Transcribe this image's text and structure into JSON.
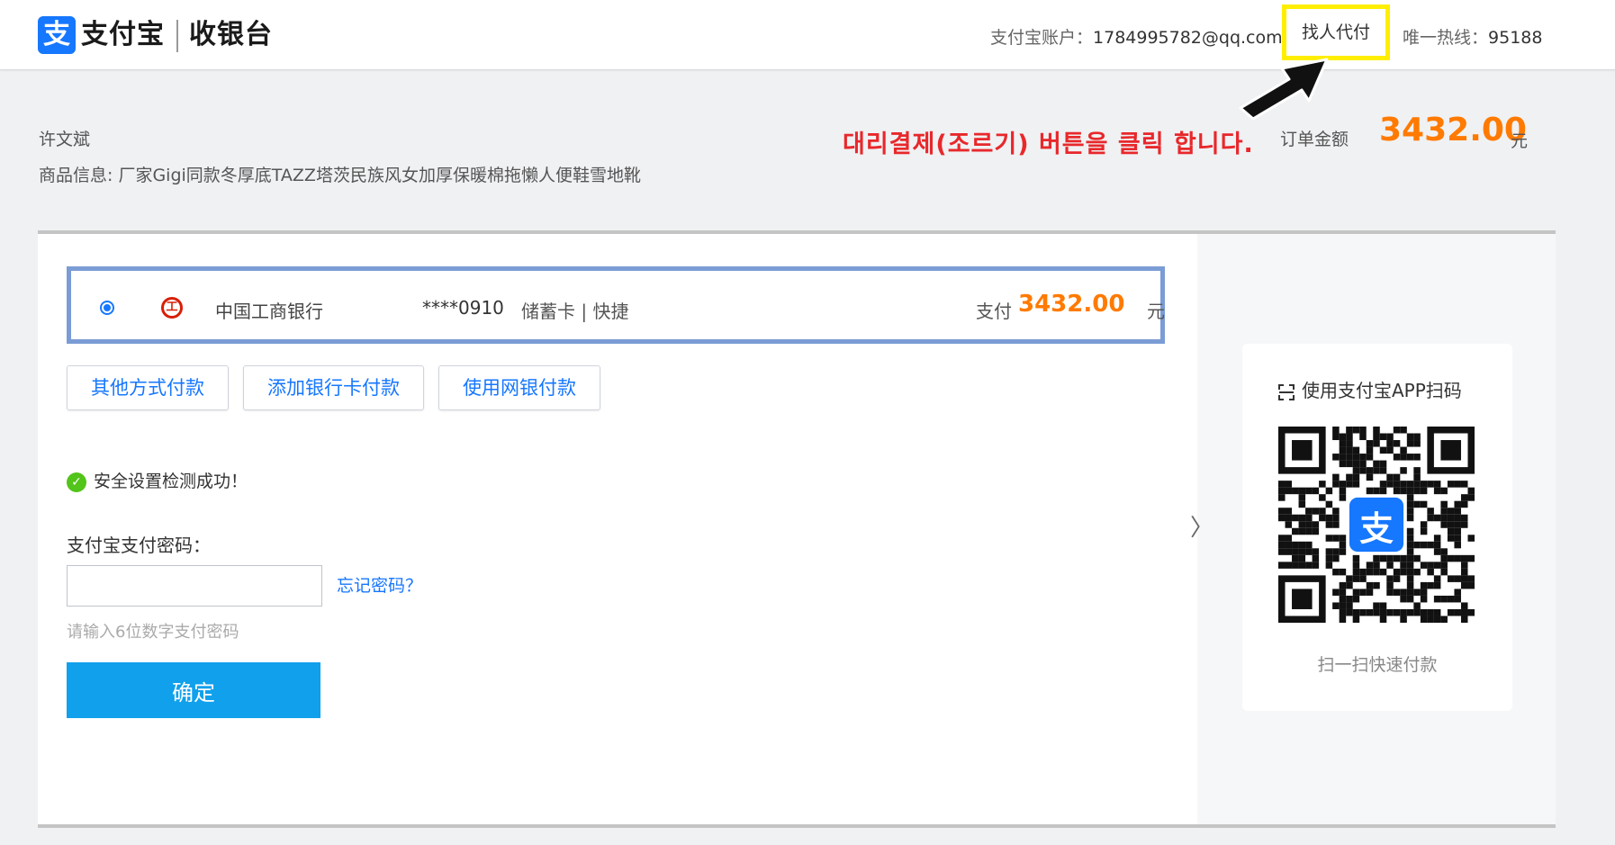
{
  "header": {
    "logo_glyph": "支",
    "brand": "支付宝",
    "subtitle": "收银台",
    "account_label": "支付宝账户：",
    "account_value": "1784995782@qq.com",
    "helper_button": "找人代付",
    "hotline_label": "唯一热线：",
    "hotline_value": "95188"
  },
  "annotation": {
    "text": "대리결제(조르기) 버튼을 클릭 합니다.",
    "color": "#e8282b",
    "highlight_color": "#ffee00"
  },
  "order": {
    "payer": "许文斌",
    "goods_info": "商品信息: 厂家Gigi同款冬厚底TAZZ塔茨民族风女加厚保暖棉拖懒人便鞋雪地靴",
    "amount_label": "订单金额",
    "amount_value": "3432.00",
    "amount_unit": "元"
  },
  "payment_method": {
    "selected": true,
    "bank_icon": "工",
    "bank_name": "中国工商银行",
    "card_number": "****0910",
    "card_type": "储蓄卡 | 快捷",
    "pay_label": "支付",
    "pay_amount": "3432.00",
    "pay_unit": "元"
  },
  "options": {
    "other": "其他方式付款",
    "add_card": "添加银行卡付款",
    "online_bank": "使用网银付款"
  },
  "security": {
    "check_glyph": "✓",
    "message": "安全设置检测成功！"
  },
  "password": {
    "label": "支付宝支付密码：",
    "value": "",
    "forgot": "忘记密码？",
    "hint": "请输入6位数字支付密码",
    "confirm": "确定"
  },
  "toggle_glyph": "〉",
  "qr": {
    "title": "使用支付宝APP扫码",
    "center_glyph": "支",
    "caption": "扫一扫快速付款"
  },
  "colors": {
    "brand_blue": "#1677ff",
    "amount_orange": "#ff7a00",
    "confirm_blue": "#10a0ec"
  }
}
